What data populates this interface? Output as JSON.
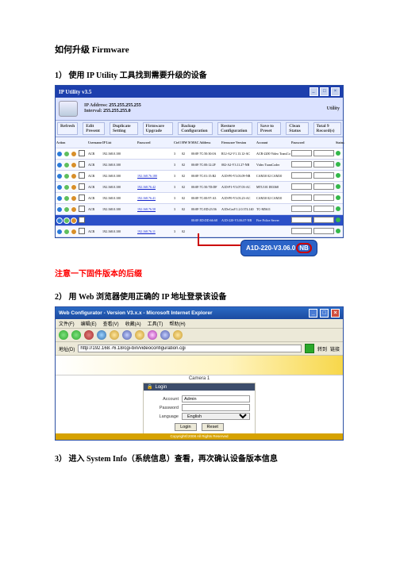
{
  "title": "如何升级 Firmware",
  "steps": {
    "s1": "1） 使用 IP Utility 工具找到需要升级的设备",
    "s2": "2） 用 Web 浏览器使用正确的 IP 地址登录该设备",
    "s3": "3） 进入 System Info（系统信息）查看，再次确认设备版本信息"
  },
  "note": "注意一下固件版本的后缀",
  "utility": {
    "title_bar": "IP Utility v3.5",
    "tab": "Utility",
    "ip_label": "IP Address:",
    "ip_value": "255.255.255.255",
    "interval_label": "Interval:",
    "interval_value": "255.255.255.0",
    "buttons": [
      "Refresh",
      "Edit Present",
      "Duplicate Setting",
      "Firmware Upgrade",
      "Backup Configuration",
      "Restore Configuration",
      "Save to Preset",
      "Clean Status",
      "Total 9 Record(s)"
    ],
    "cols": [
      "Action",
      "",
      "IP List",
      "Username",
      "Password",
      "Ctrl ID",
      "HW MAC",
      "MAC Address",
      "Firmware Version",
      "Account",
      "Password",
      "Status"
    ],
    "rows": [
      {
        "user": "ACR",
        "ip": "192.168.0.100",
        "link": "",
        "cnt": "3",
        "id": "02",
        "mac": "00:0F:7C:50:30:0A",
        "ver": "R12-A2-V1.13.12-AC",
        "acc": "ACR-2200 Video TransCoder",
        "sel": false
      },
      {
        "user": "ACR",
        "ip": "192.168.0.100",
        "link": "",
        "cnt": "3",
        "id": "02",
        "mac": "00:0F:7C:00:12:2F",
        "ver": "002-A2-V3.11.27-NB",
        "acc": "Video TransCoder",
        "sel": false
      },
      {
        "user": "ACR",
        "ip": "192.168.0.100",
        "link": "192.168.76.180",
        "cnt": "3",
        "id": "02",
        "mac": "00:0F:7C:01:15:B2",
        "ver": "A1D-P0-V3.03.09-NR",
        "acc": "CAM10 02 CAM10",
        "sel": false
      },
      {
        "user": "ACR",
        "ip": "192.168.0.100",
        "link": "192.168.76.42",
        "cnt": "3",
        "id": "02",
        "mac": "00:0F:7C:50:7D:DF",
        "ver": "A1D-P1-V3.07.03-AC",
        "acc": "MTU101 IR3368",
        "sel": false
      },
      {
        "user": "ACR",
        "ip": "192.168.0.100",
        "link": "192.168.76.41",
        "cnt": "3",
        "id": "02",
        "mac": "00:0F:7C:00:97:A3",
        "ver": "A1D-P0-V3.03.23-AC",
        "acc": "CAM10 02 CAM10",
        "sel": false
      },
      {
        "user": "ACR",
        "ip": "192.168.0.100",
        "link": "192.168.76.58",
        "cnt": "3",
        "id": "02",
        "mac": "00:0F:7C:ED:23:56",
        "ver": "A1DvCmV1.2.0.374.140",
        "acc": "TC-M5611",
        "sel": false
      },
      {
        "user": "",
        "ip": "",
        "link": "",
        "cnt": "",
        "id": "",
        "mac": "00:0F:ED:DD:66:68",
        "ver": "A1D-220-V3.06.07-NB",
        "acc": "Fire Police Server",
        "sel": true
      },
      {
        "user": "ACR",
        "ip": "192.168.0.100",
        "link": "192.168.76.11",
        "cnt": "3",
        "id": "02",
        "mac": "",
        "ver": "",
        "acc": "",
        "sel": false
      }
    ]
  },
  "callout": "A1D-220-V3.06.07-NB",
  "callout_tail": "NB",
  "ie": {
    "title": "Web Configurator - Version V3.x.x - Microsoft Internet Explorer",
    "menu": [
      "文件(F)",
      "编辑(E)",
      "查看(V)",
      "收藏(A)",
      "工具(T)",
      "帮助(H)"
    ],
    "addr_label": "地址(D)",
    "addr_value": "http://192.168.76.18/cgi-bin/videoconfiguration.cgi",
    "go": "转到",
    "links": "链接",
    "camera": "Camera 1",
    "login_title": "Login",
    "account_label": "Account",
    "account_value": "Admin",
    "password_label": "Password",
    "language_label": "Language",
    "language_value": "English",
    "login_btn": "Login",
    "reset_btn": "Reset",
    "footer": "Copyright©2008 All Rights Reserved"
  }
}
